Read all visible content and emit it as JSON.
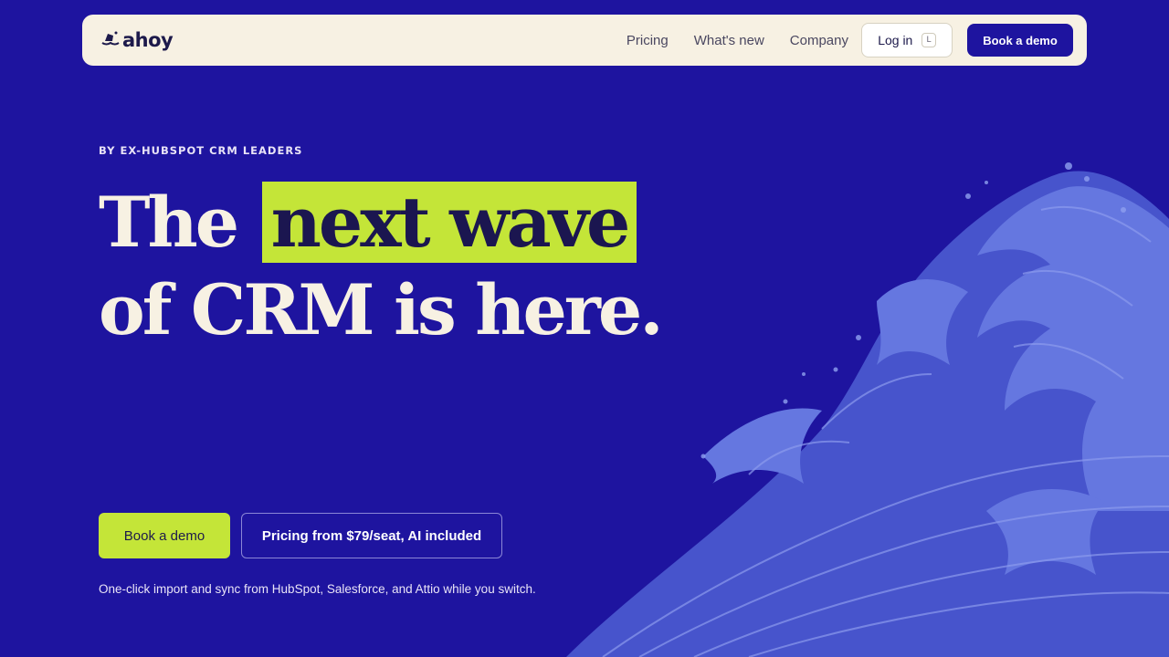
{
  "nav": {
    "logo_text": "ahoy",
    "links": [
      "Pricing",
      "What's new",
      "Company"
    ],
    "login_label": "Log in",
    "login_shortcut": "L",
    "demo_label": "Book a demo"
  },
  "hero": {
    "eyebrow": "BY EX-HUBSPOT CRM LEADERS",
    "headline_part1": "The",
    "headline_highlight": "next wave",
    "headline_line2": "of CRM is here.",
    "cta_primary": "Book a demo",
    "cta_secondary": "Pricing from $79/seat, AI included",
    "subtext": "One-click import and sync from HubSpot, Salesforce, and Attio while you switch."
  },
  "colors": {
    "background": "#1e149f",
    "accent": "#c4e538",
    "cream": "#f7f1e3",
    "wave": "#5b6bd8"
  }
}
